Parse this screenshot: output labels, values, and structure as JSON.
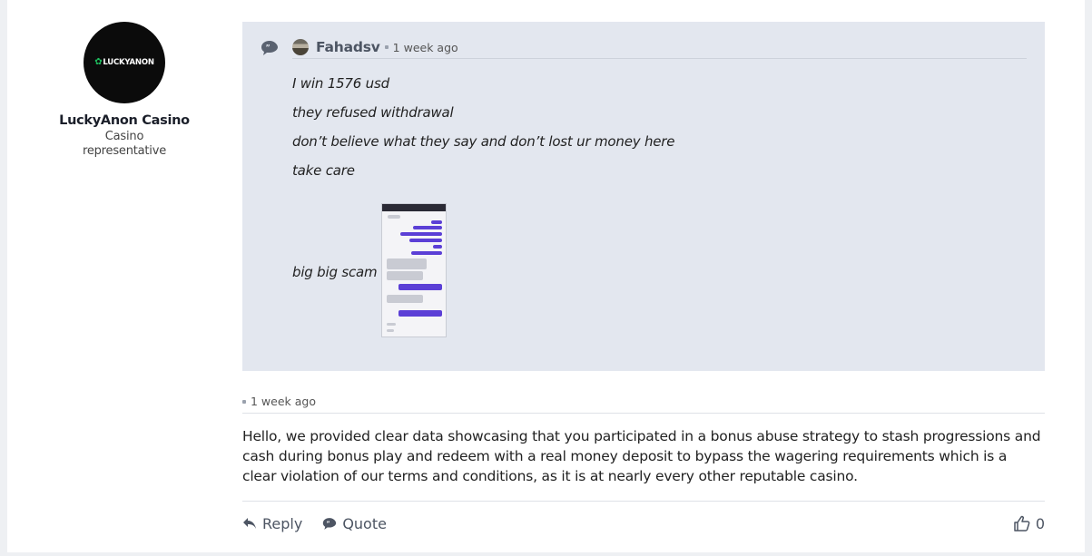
{
  "representative": {
    "logo_text": "LUCKYANON",
    "name": "LuckyAnon Casino",
    "title": "Casino representative"
  },
  "quote": {
    "author": "Fahadsv",
    "time": "1 week ago",
    "lines": [
      "I win 1576 usd",
      "they refused withdrawal",
      "don’t believe what they say and don’t lost ur money here",
      "take care"
    ],
    "last_line": "big big scam"
  },
  "reply": {
    "time": "1 week ago",
    "text": "Hello, we provided clear data showcasing that you participated in a bonus abuse strategy to stash progressions and cash during bonus play and redeem with a real money deposit to bypass the wagering requirements which is a clear violation of our terms and conditions, as it is at nearly every other reputable casino."
  },
  "actions": {
    "reply_label": "Reply",
    "quote_label": "Quote",
    "like_count": "0"
  },
  "icons": [
    "quote-bubble-icon",
    "reply-arrow-icon",
    "quote-icon",
    "thumbs-up-icon"
  ],
  "colors": {
    "quote_bg": "#e3e7ef",
    "accent_text": "#4d5563",
    "avatar_bg": "#0b0b0b"
  }
}
